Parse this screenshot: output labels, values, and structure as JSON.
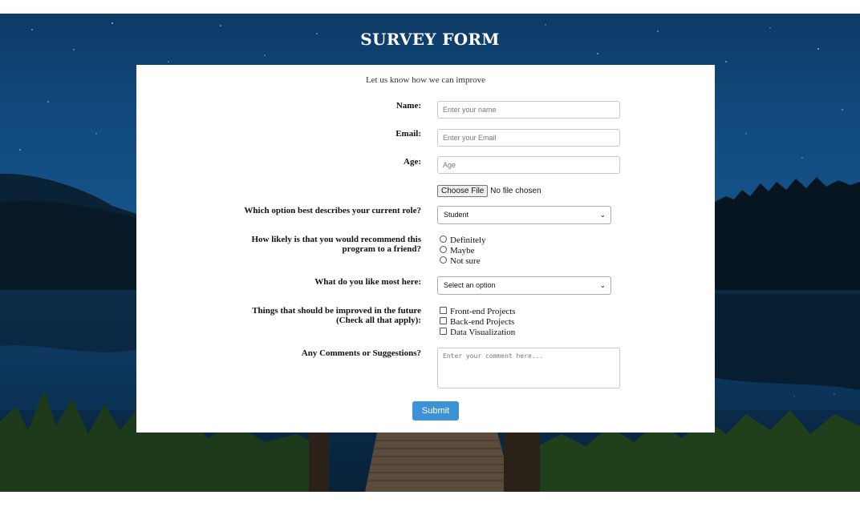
{
  "page": {
    "title": "SURVEY FORM",
    "subtitle": "Let us know how we can improve"
  },
  "fields": {
    "name": {
      "label": "Name:",
      "placeholder": "Enter your name"
    },
    "email": {
      "label": "Email:",
      "placeholder": "Enter your Email"
    },
    "age": {
      "label": "Age:",
      "placeholder": "Age"
    },
    "file": {
      "button": "Choose File",
      "status": "No file chosen"
    },
    "role": {
      "label": "Which option best describes your current role?",
      "selected": "Student"
    },
    "recommend": {
      "label_line1": "How likely is that you would recommend this",
      "label_line2": "program to a friend?",
      "options": [
        "Definitely",
        "Maybe",
        "Not sure"
      ]
    },
    "like_most": {
      "label": "What do you like most here:",
      "selected": "Select an option"
    },
    "improve": {
      "label_line1": "Things that should be improved in the future",
      "label_line2": "(Check all that apply):",
      "options": [
        "Front-end Projects",
        "Back-end Projects",
        "Data Visualization"
      ]
    },
    "comments": {
      "label": "Any Comments or Suggestions?",
      "placeholder": "Enter your comment here..."
    }
  },
  "submit": {
    "label": "Submit"
  },
  "icons": {
    "dropdown": "chevron-down-icon",
    "radio": "radio-icon",
    "checkbox": "checkbox-icon"
  },
  "colors": {
    "accent": "#3c92d7",
    "sky": "#11497c",
    "card": "#ffffff"
  }
}
